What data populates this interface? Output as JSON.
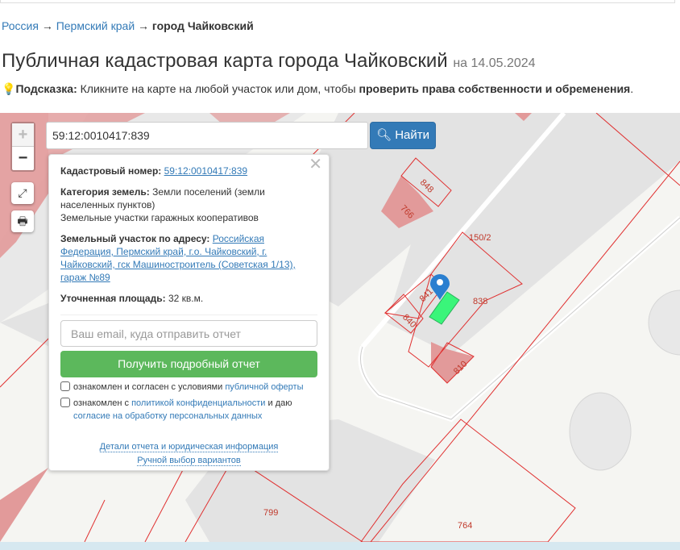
{
  "breadcrumb": {
    "items": [
      "Россия",
      "Пермский край"
    ],
    "sep": "→",
    "current": "город Чайковский"
  },
  "title": "Публичная кадастровая карта города Чайковский",
  "title_date": "на 14.05.2024",
  "hint": {
    "label": "Подсказка:",
    "text": " Кликните на карте на любой участок или дом, чтобы ",
    "bold": "проверить права собственности и обременения",
    "end": "."
  },
  "map": {
    "zoom_in": "+",
    "zoom_out": "−",
    "search_value": "59:12:0010417:839",
    "find_label": "Найти",
    "parcel_labels": [
      "848",
      "766",
      "150/2",
      "841",
      "838",
      "840",
      "810",
      "799",
      "764"
    ]
  },
  "popup": {
    "cad_label": "Кадастровый номер:",
    "cad_value": "59:12:0010417:839",
    "cat_label": "Категория земель:",
    "cat_value": "Земли поселений (земли населенных пунктов)",
    "use_value": "Земельные участки гаражных кооперативов",
    "addr_label": "Земельный участок по адресу:",
    "addr_value": "Российская Федерация, Пермский край, г.о. Чайковский, г. Чайковский, гск Машиностроитель (Советская 1/13), гараж №89",
    "area_label": "Уточненная площадь:",
    "area_value": "32 кв.м.",
    "email_placeholder": "Ваш email, куда отправить отчет",
    "get_report": "Получить подробный отчет",
    "chk1_text": "ознакомлен и согласен с условиями ",
    "chk1_link": "публичной оферты",
    "chk2_text": "ознакомлен с ",
    "chk2_link": "политикой конфиденциальности",
    "chk2_text2": " и даю ",
    "chk2_link2": "согласие на обработку персональных данных",
    "details_link": "Детали отчета и юридическая информация",
    "manual_link": "Ручной выбор вариантов"
  }
}
